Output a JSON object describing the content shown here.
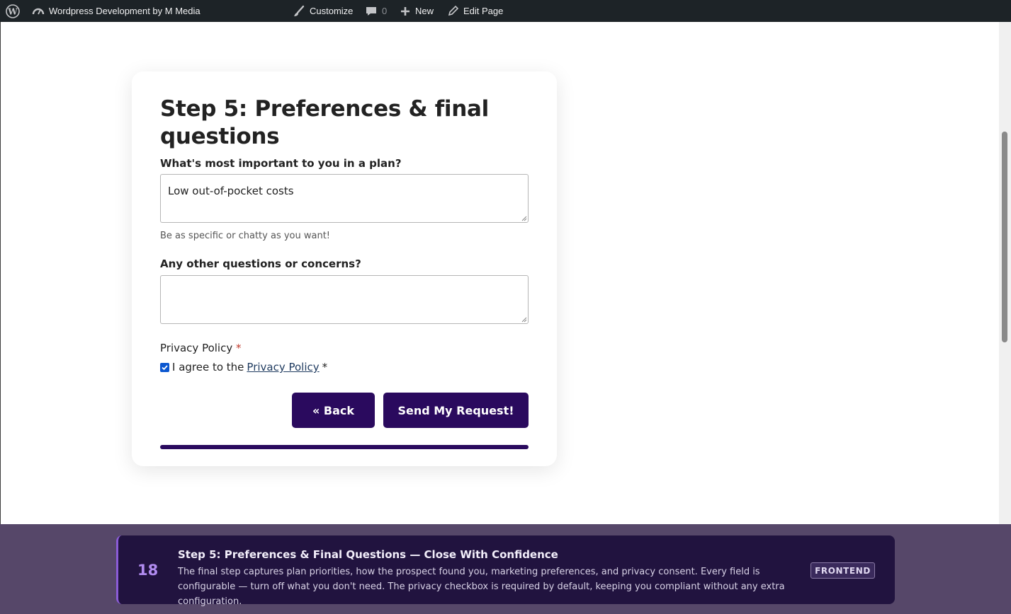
{
  "admin_bar": {
    "site_title": "Wordpress Development by M Media",
    "customize": "Customize",
    "comments_count": "0",
    "new": "New",
    "edit_page": "Edit Page"
  },
  "form": {
    "title": "Step 5: Preferences & final questions",
    "field1": {
      "label": "What's most important to you in a plan?",
      "value": "Low out-of-pocket costs",
      "help": "Be as specific or chatty as you want!"
    },
    "field2": {
      "label": "Any other questions or concerns?",
      "value": ""
    },
    "privacy": {
      "label": "Privacy Policy",
      "required_mark": "*",
      "checkbox_prefix": "I agree to the",
      "link_text": "Privacy Policy",
      "checkbox_suffix": "*",
      "checked": true
    },
    "back_label": "« Back",
    "submit_label": "Send My Request!",
    "progress": 1.0
  },
  "banner": {
    "number": "18",
    "title": "Step 5: Preferences & Final Questions — Close With Confidence",
    "description": "The final step captures plan priorities, how the prospect found you, marketing preferences, and privacy consent. Every field is configurable — turn off what you don't need. The privacy checkbox is required by default, keeping you compliant without any extra configuration.",
    "badge": "FRONTEND"
  },
  "colors": {
    "admin_bar_bg": "#1d2327",
    "button_bg": "#2a0a5e",
    "banner_bg": "#21133f",
    "banner_accent": "#8a5cd6"
  }
}
